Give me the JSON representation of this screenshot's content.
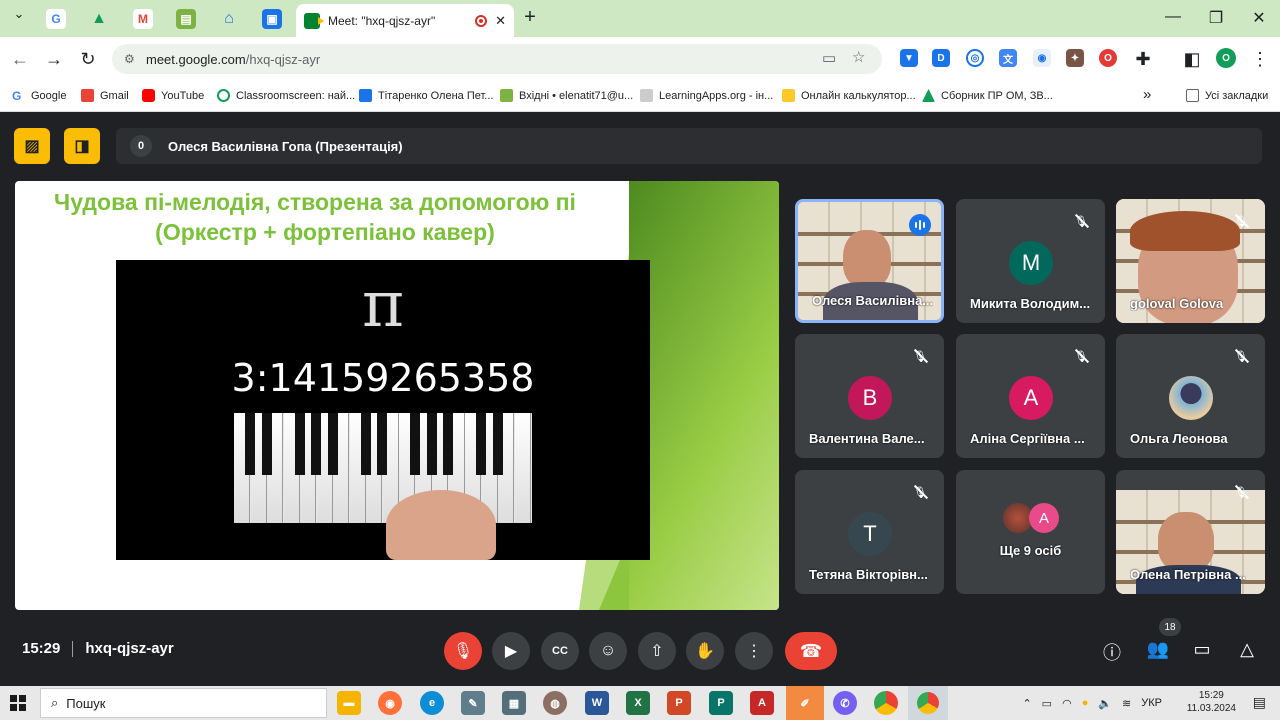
{
  "browser": {
    "active_tab_title": "Meet: \"hxq-qjsz-ayr\"",
    "new_tab_symbol": "+",
    "url_domain": "meet.google.com",
    "url_path": "/hxq-qjsz-ayr",
    "profile_initial": "O"
  },
  "bookmarks": {
    "items": [
      "Google",
      "Gmail",
      "YouTube",
      "Classroomscreen: най...",
      "Тітаренко Олена Пет...",
      "Вхідні • elenatit71@u...",
      "LearningApps.org - ін...",
      "Онлайн калькулятор...",
      "Сборник ПР ОМ, ЗВ..."
    ],
    "more": "»",
    "all_bookmarks": "Усі закладки"
  },
  "meet": {
    "presenter_count": "0",
    "presenter_label": "Олеся Василівна Гопа (Презентація)",
    "slide": {
      "title_line1": "Чудова пі-мелодія, створена за допомогою пі",
      "title_line2": "(Оркестр + фортепіано кавер)",
      "pi_symbol": "π",
      "pi_digits": "3:14159265358"
    },
    "participants": [
      {
        "name": "Олеся Василівна...",
        "initial": ""
      },
      {
        "name": "Микита Володим...",
        "initial": "М"
      },
      {
        "name": "goloval Golova",
        "initial": ""
      },
      {
        "name": "Валентина Вале...",
        "initial": "В"
      },
      {
        "name": "Аліна Сергіївна ...",
        "initial": "А"
      },
      {
        "name": "Ольга Леонова",
        "initial": ""
      },
      {
        "name": "Тетяна Вікторівн...",
        "initial": "Т"
      },
      {
        "name": "Ще 9 осіб",
        "initial": "А"
      },
      {
        "name": "Олена Петрівна ...",
        "initial": ""
      }
    ],
    "time": "15:29",
    "meeting_code": "hxq-qjsz-ayr",
    "people_count": "18"
  },
  "taskbar": {
    "search_placeholder": "Пошук",
    "lang": "УКР",
    "clock_time": "15:29",
    "clock_date": "11.03.2024"
  },
  "colors": {
    "tile_bg": "#3c4043",
    "accent_red": "#ea4335",
    "yellow_buttons": "#fbbc04",
    "slide_green": "#7cc13a"
  }
}
